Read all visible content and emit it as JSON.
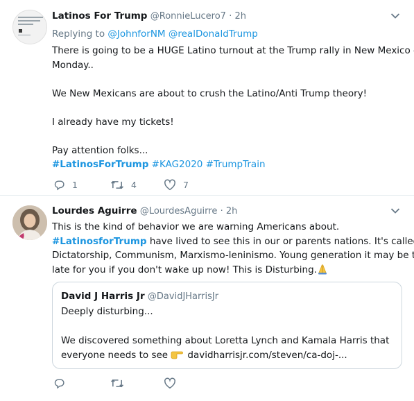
{
  "tweets": [
    {
      "name": "Latinos For Trump",
      "handle": "@RonnieLucero7",
      "time": "· 2h",
      "replying_label": "Replying to",
      "replying_to": [
        "@JohnforNM",
        "@realDonaldTrump"
      ],
      "lines": [
        "There is going to be a HUGE Latino turnout at the Trump rally in New Mexico on",
        "Monday..",
        "",
        "We New Mexicans are about to crush the Latino/Anti Trump theory!",
        "",
        "I already have my tickets!",
        "",
        "Pay attention folks..."
      ],
      "hashtags": [
        "#LatinosForTrump",
        "#KAG2020",
        "#TrumpTrain"
      ],
      "counts": {
        "reply": "1",
        "retweet": "4",
        "like": "7"
      }
    },
    {
      "name": "Lourdes Aguirre",
      "handle": "@LourdesAguirre",
      "time": "· 2h",
      "line1": "This is the kind of behavior we are warning Americans about.",
      "hashtag": "#LatinosforTrump",
      "line2_rest": " have lived to see this in our or parents nations. It's called",
      "line3": "Dictatorship, Communism, Marxismo-leninismo. Young generation it may be too",
      "line4": "late for you if you don't wake up now! This is Disturbing.",
      "emoji": "folded-hands",
      "quote": {
        "name": "David J Harris Jr",
        "handle": "@DavidJHarrisJr",
        "line1": "Deeply disturbing...",
        "line2": "We discovered something about Loretta Lynch and Kamala Harris that",
        "line3_text": "everyone needs to see",
        "line3_emoji": "pointing-hand",
        "link": "davidharrisjr.com/steven/ca-doj-..."
      },
      "counts": {
        "reply": "",
        "retweet": "",
        "like": ""
      }
    }
  ],
  "colors": {
    "text": "#14171a",
    "muted": "#657786",
    "link": "#1b95e0",
    "border": "#e6ecf0"
  },
  "icons": [
    "chevron-down-icon",
    "reply-icon",
    "retweet-icon",
    "like-icon"
  ]
}
